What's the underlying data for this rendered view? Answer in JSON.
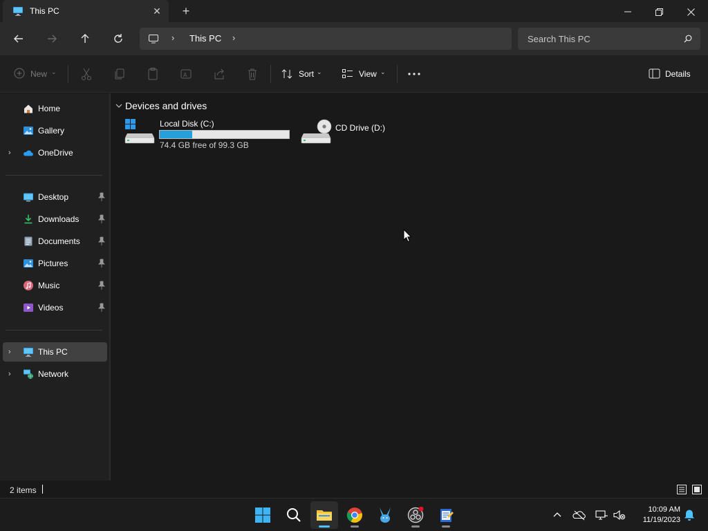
{
  "window": {
    "tab_title": "This PC",
    "tab_icon": "this-pc-icon"
  },
  "address": {
    "location": "This PC",
    "search_placeholder": "Search This PC"
  },
  "toolbar": {
    "new_label": "New",
    "sort_label": "Sort",
    "view_label": "View",
    "details_label": "Details"
  },
  "sidebar": {
    "top_items": [
      {
        "label": "Home",
        "icon": "home-icon"
      },
      {
        "label": "Gallery",
        "icon": "gallery-icon"
      },
      {
        "label": "OneDrive",
        "icon": "onedrive-icon"
      }
    ],
    "quick_access": [
      {
        "label": "Desktop",
        "icon": "desktop-icon"
      },
      {
        "label": "Downloads",
        "icon": "downloads-icon"
      },
      {
        "label": "Documents",
        "icon": "documents-icon"
      },
      {
        "label": "Pictures",
        "icon": "pictures-icon"
      },
      {
        "label": "Music",
        "icon": "music-icon"
      },
      {
        "label": "Videos",
        "icon": "videos-icon"
      }
    ],
    "bottom_items": [
      {
        "label": "This PC",
        "icon": "this-pc-icon",
        "selected": true
      },
      {
        "label": "Network",
        "icon": "network-icon"
      }
    ]
  },
  "content": {
    "group_title": "Devices and drives",
    "drives": [
      {
        "name": "Local Disk (C:)",
        "free_text": "74.4 GB free of 99.3 GB",
        "used_fraction": 0.25
      },
      {
        "name": "CD Drive (D:)"
      }
    ]
  },
  "status": {
    "item_count": "2 items"
  },
  "taskbar": {
    "time": "10:09 AM",
    "date": "11/19/2023"
  },
  "colors": {
    "accent": "#4cc2ff",
    "drive_fill": "#26a0da",
    "background": "#191919"
  }
}
